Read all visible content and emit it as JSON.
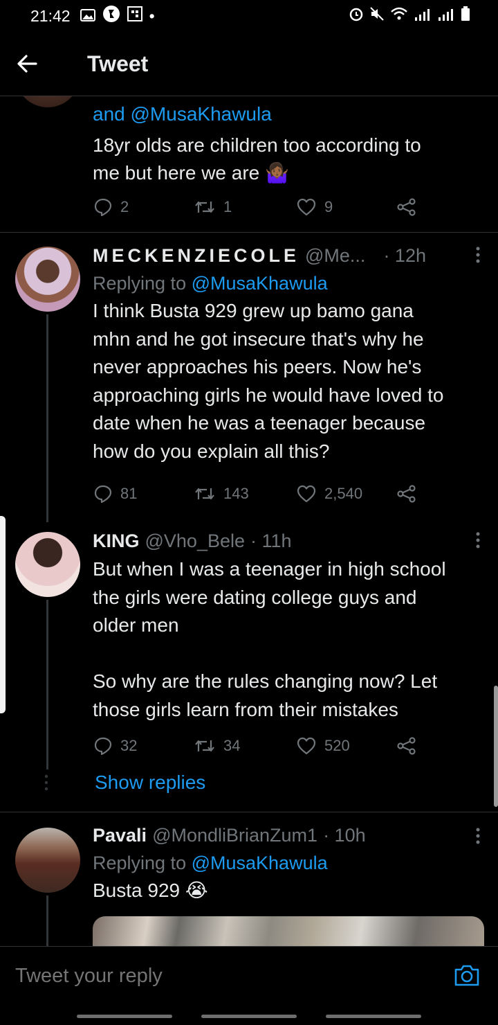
{
  "status_bar": {
    "time": "21:42",
    "dot": "•"
  },
  "header": {
    "title": "Tweet"
  },
  "tweets": [
    {
      "mention_line": "and @MusaKhawula",
      "text": "18yr olds are children too according to\nme but here we are 🤷🏾‍♀️",
      "replies": "2",
      "retweets": "1",
      "likes": "9"
    },
    {
      "name": "MECKENZIECOLE",
      "handle": "@Me...",
      "time": "· 12h",
      "replying_prefix": "Replying to ",
      "replying_mention": "@MusaKhawula",
      "text": "I think Busta 929 grew up bamo gana\nmhn and he got insecure that's why he\nnever approaches his peers. Now he's\napproaching girls he would have loved to\ndate when he was a teenager because\nhow do you explain all this?",
      "replies": "81",
      "retweets": "143",
      "likes": "2,540"
    },
    {
      "name": "KING",
      "handle": "@Vho_Bele",
      "time": "· 11h",
      "text": "But when I was a teenager in high school\nthe girls were dating college guys and\nolder men\n\nSo why are the rules changing now? Let\nthose girls learn from their mistakes",
      "replies": "32",
      "retweets": "34",
      "likes": "520",
      "show_replies": "Show replies"
    },
    {
      "name": "Pavali",
      "handle": "@MondliBrianZum1",
      "time": "· 10h",
      "replying_prefix": "Replying to ",
      "replying_mention": "@MusaKhawula",
      "text": "Busta 929 😭"
    }
  ],
  "reply_bar": {
    "placeholder": "Tweet your reply"
  },
  "colors": {
    "background": "#000000",
    "accent": "#1d9bf0",
    "muted": "#71767b",
    "text": "#e7e9ea"
  },
  "icons": [
    "back-arrow-icon",
    "reply-icon",
    "retweet-icon",
    "like-icon",
    "share-icon",
    "more-icon",
    "camera-icon"
  ]
}
